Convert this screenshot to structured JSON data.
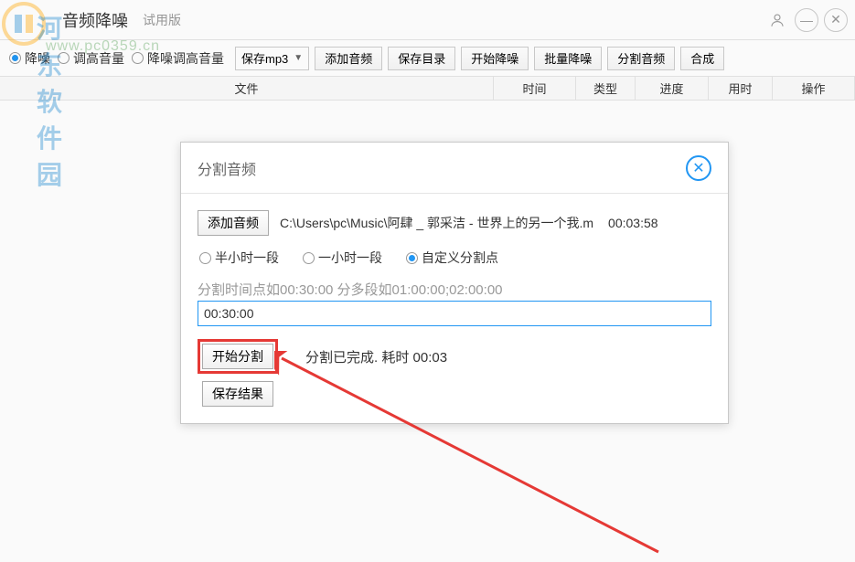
{
  "watermark": {
    "text": "河东软件园",
    "url": "www.pc0359.cn"
  },
  "titlebar": {
    "title": "音频降噪",
    "subtitle": "试用版"
  },
  "toolbar": {
    "radios": [
      {
        "label": "降噪",
        "checked": true
      },
      {
        "label": "调高音量",
        "checked": false
      },
      {
        "label": "降噪调高音量",
        "checked": false
      }
    ],
    "format_select": "保存mp3",
    "buttons": [
      "添加音频",
      "保存目录",
      "开始降噪",
      "批量降噪",
      "分割音频",
      "合成"
    ]
  },
  "table": {
    "headers": {
      "file": "文件",
      "time": "时间",
      "type": "类型",
      "progress": "进度",
      "elapsed": "用时",
      "action": "操作"
    }
  },
  "dialog": {
    "title": "分割音频",
    "add_audio": "添加音频",
    "file_path": "C:\\Users\\pc\\Music\\阿肆 _ 郭采洁 - 世界上的另一个我.m",
    "duration": "00:03:58",
    "split_options": [
      {
        "label": "半小时一段",
        "checked": false
      },
      {
        "label": "一小时一段",
        "checked": false
      },
      {
        "label": "自定义分割点",
        "checked": true
      }
    ],
    "hint": "分割时间点如00:30:00 分多段如01:00:00;02:00:00",
    "time_value": "00:30:00",
    "start_split": "开始分割",
    "status": "分割已完成. 耗时 00:03",
    "save_result": "保存结果"
  }
}
